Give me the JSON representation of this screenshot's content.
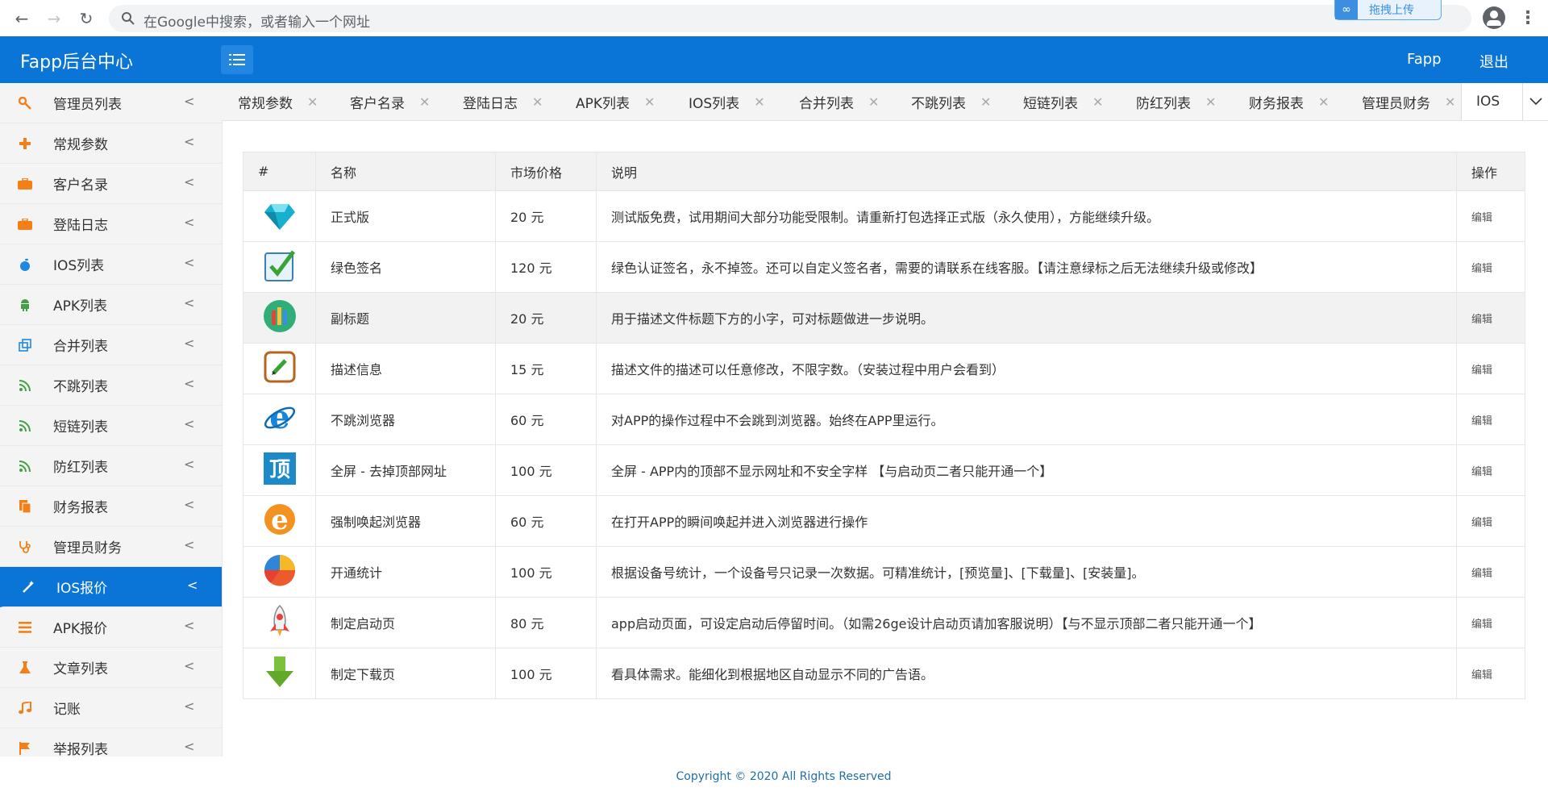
{
  "browser": {
    "omnibox_placeholder": "在Google中搜索，或者输入一个网址",
    "upload_badge": "拖拽上传"
  },
  "header": {
    "brand": "Fapp后台中心",
    "user": "Fapp",
    "logout": "退出"
  },
  "sidebar": {
    "items": [
      {
        "label": "管理员列表",
        "icon": "wrench-icon",
        "color": "#f57f17"
      },
      {
        "label": "常规参数",
        "icon": "plus-icon",
        "color": "#f57f17"
      },
      {
        "label": "客户名录",
        "icon": "briefcase-icon",
        "color": "#f57f17"
      },
      {
        "label": "登陆日志",
        "icon": "briefcase-icon",
        "color": "#f57f17"
      },
      {
        "label": "IOS列表",
        "icon": "apple-icon",
        "color": "#1e88e5"
      },
      {
        "label": "APK列表",
        "icon": "android-icon",
        "color": "#43a047"
      },
      {
        "label": "合并列表",
        "icon": "clone-icon",
        "color": "#1e88e5"
      },
      {
        "label": "不跳列表",
        "icon": "rss-icon",
        "color": "#43a047"
      },
      {
        "label": "短链列表",
        "icon": "rss-icon",
        "color": "#43a047"
      },
      {
        "label": "防红列表",
        "icon": "rss-icon",
        "color": "#43a047"
      },
      {
        "label": "财务报表",
        "icon": "file-icon",
        "color": "#f57f17"
      },
      {
        "label": "管理员财务",
        "icon": "stethoscope-icon",
        "color": "#f57f17"
      },
      {
        "label": "IOS报价",
        "icon": "magic-icon",
        "color": "#ffffff",
        "active": true
      },
      {
        "label": "APK报价",
        "icon": "bars-icon",
        "color": "#f57f17"
      },
      {
        "label": "文章列表",
        "icon": "flask-icon",
        "color": "#f57f17"
      },
      {
        "label": "记账",
        "icon": "music-icon",
        "color": "#f57f17"
      },
      {
        "label": "举报列表",
        "icon": "flag-icon",
        "color": "#f57f17"
      }
    ]
  },
  "tabs": [
    {
      "label": "常规参数"
    },
    {
      "label": "客户名录"
    },
    {
      "label": "登陆日志"
    },
    {
      "label": "APK列表"
    },
    {
      "label": "IOS列表"
    },
    {
      "label": "合并列表"
    },
    {
      "label": "不跳列表"
    },
    {
      "label": "短链列表"
    },
    {
      "label": "防红列表"
    },
    {
      "label": "财务报表"
    },
    {
      "label": "管理员财务"
    },
    {
      "label": "IOS",
      "active": true
    }
  ],
  "table": {
    "headers": [
      "#",
      "名称",
      "市场价格",
      "说明",
      "操作"
    ],
    "edit_label": "编辑",
    "rows": [
      {
        "icon": "diamond-icon",
        "name": "正式版",
        "price": "20 元",
        "desc": "测试版免费，试用期间大部分功能受限制。请重新打包选择正式版（永久使用），方能继续升级。"
      },
      {
        "icon": "checkbox-icon",
        "name": "绿色签名",
        "price": "120 元",
        "desc": "绿色认证签名，永不掉签。还可以自定义签名者，需要的请联系在线客服。【请注意绿标之后无法继续升级或修改】"
      },
      {
        "icon": "pencils-icon",
        "name": "副标题",
        "price": "20 元",
        "desc": "用于描述文件标题下方的小字，可对标题做进一步说明。"
      },
      {
        "icon": "edit-note-icon",
        "name": "描述信息",
        "price": "15 元",
        "desc": "描述文件的描述可以任意修改，不限字数。（安装过程中用户会看到）"
      },
      {
        "icon": "ie-blue-icon",
        "name": "不跳浏览器",
        "price": "60 元",
        "desc": "对APP的操作过程中不会跳到浏览器。始终在APP里运行。"
      },
      {
        "icon": "top-icon",
        "name": "全屏 - 去掉顶部网址",
        "price": "100 元",
        "desc": "全屏 - APP内的顶部不显示网址和不安全字样 【与启动页二者只能开通一个】"
      },
      {
        "icon": "ie-orange-icon",
        "name": "强制唤起浏览器",
        "price": "60 元",
        "desc": "在打开APP的瞬间唤起并进入浏览器进行操作"
      },
      {
        "icon": "pie-icon",
        "name": "开通统计",
        "price": "100 元",
        "desc": "根据设备号统计，一个设备号只记录一次数据。可精准统计，[预览量]、[下载量]、[安装量]。"
      },
      {
        "icon": "rocket-icon",
        "name": "制定启动页",
        "price": "80 元",
        "desc": "app启动页面，可设定启动后停留时间。（如需26ge设计启动页请加客服说明）【与不显示顶部二者只能开通一个】"
      },
      {
        "icon": "download-arrow-icon",
        "name": "制定下载页",
        "price": "100 元",
        "desc": "看具体需求。能细化到根据地区自动显示不同的广告语。"
      }
    ]
  },
  "footer": "Copyright © 2020 All Rights Reserved"
}
